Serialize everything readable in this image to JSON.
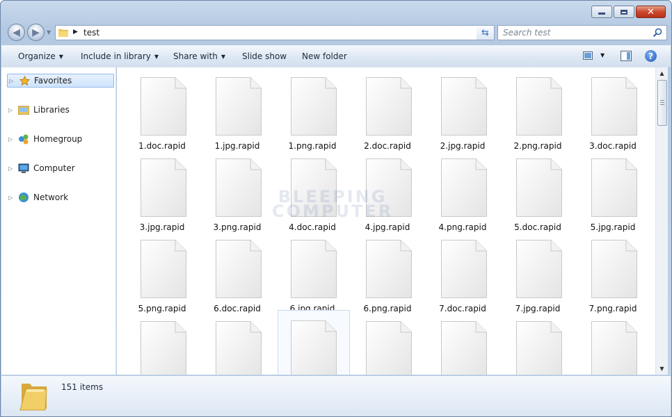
{
  "address": {
    "path": "test"
  },
  "search": {
    "placeholder": "Search test"
  },
  "toolbar": {
    "organize": "Organize",
    "include_in_library": "Include in library",
    "share_with": "Share with",
    "slide_show": "Slide show",
    "new_folder": "New folder"
  },
  "navpane": {
    "items": [
      {
        "label": "Favorites",
        "icon": "star-icon"
      },
      {
        "label": "Libraries",
        "icon": "libraries-icon"
      },
      {
        "label": "Homegroup",
        "icon": "homegroup-icon"
      },
      {
        "label": "Computer",
        "icon": "computer-icon"
      },
      {
        "label": "Network",
        "icon": "network-icon"
      }
    ]
  },
  "files": [
    "1.doc.rapid",
    "1.jpg.rapid",
    "1.png.rapid",
    "2.doc.rapid",
    "2.jpg.rapid",
    "2.png.rapid",
    "3.doc.rapid",
    "3.jpg.rapid",
    "3.png.rapid",
    "4.doc.rapid",
    "4.jpg.rapid",
    "4.png.rapid",
    "5.doc.rapid",
    "5.jpg.rapid",
    "5.png.rapid",
    "6.doc.rapid",
    "6.jpg.rapid",
    "6.png.rapid",
    "7.doc.rapid",
    "7.jpg.rapid",
    "7.png.rapid",
    "",
    "",
    "",
    "",
    "",
    "",
    ""
  ],
  "watermark": {
    "line1": "BLEEPING",
    "line2": "COMPUTER"
  },
  "status": {
    "item_count": "151 items"
  },
  "colors": {
    "accent": "#2f6cc2",
    "selection": "#cfe4fb",
    "close_button": "#c9482d"
  }
}
